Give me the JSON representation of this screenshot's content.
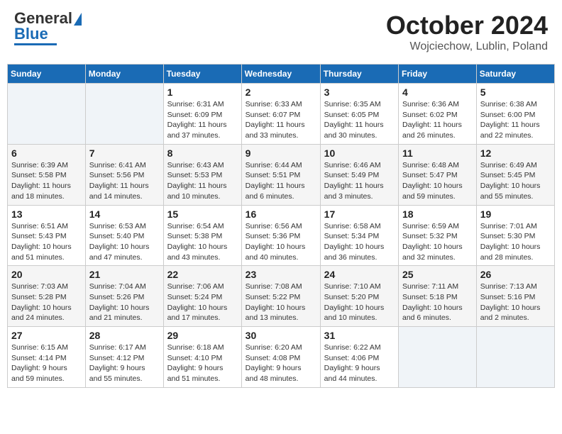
{
  "header": {
    "logo_line1": "General",
    "logo_line2": "Blue",
    "month": "October 2024",
    "location": "Wojciechow, Lublin, Poland"
  },
  "weekdays": [
    "Sunday",
    "Monday",
    "Tuesday",
    "Wednesday",
    "Thursday",
    "Friday",
    "Saturday"
  ],
  "weeks": [
    [
      {
        "day": "",
        "info": ""
      },
      {
        "day": "",
        "info": ""
      },
      {
        "day": "1",
        "info": "Sunrise: 6:31 AM\nSunset: 6:09 PM\nDaylight: 11 hours\nand 37 minutes."
      },
      {
        "day": "2",
        "info": "Sunrise: 6:33 AM\nSunset: 6:07 PM\nDaylight: 11 hours\nand 33 minutes."
      },
      {
        "day": "3",
        "info": "Sunrise: 6:35 AM\nSunset: 6:05 PM\nDaylight: 11 hours\nand 30 minutes."
      },
      {
        "day": "4",
        "info": "Sunrise: 6:36 AM\nSunset: 6:02 PM\nDaylight: 11 hours\nand 26 minutes."
      },
      {
        "day": "5",
        "info": "Sunrise: 6:38 AM\nSunset: 6:00 PM\nDaylight: 11 hours\nand 22 minutes."
      }
    ],
    [
      {
        "day": "6",
        "info": "Sunrise: 6:39 AM\nSunset: 5:58 PM\nDaylight: 11 hours\nand 18 minutes."
      },
      {
        "day": "7",
        "info": "Sunrise: 6:41 AM\nSunset: 5:56 PM\nDaylight: 11 hours\nand 14 minutes."
      },
      {
        "day": "8",
        "info": "Sunrise: 6:43 AM\nSunset: 5:53 PM\nDaylight: 11 hours\nand 10 minutes."
      },
      {
        "day": "9",
        "info": "Sunrise: 6:44 AM\nSunset: 5:51 PM\nDaylight: 11 hours\nand 6 minutes."
      },
      {
        "day": "10",
        "info": "Sunrise: 6:46 AM\nSunset: 5:49 PM\nDaylight: 11 hours\nand 3 minutes."
      },
      {
        "day": "11",
        "info": "Sunrise: 6:48 AM\nSunset: 5:47 PM\nDaylight: 10 hours\nand 59 minutes."
      },
      {
        "day": "12",
        "info": "Sunrise: 6:49 AM\nSunset: 5:45 PM\nDaylight: 10 hours\nand 55 minutes."
      }
    ],
    [
      {
        "day": "13",
        "info": "Sunrise: 6:51 AM\nSunset: 5:43 PM\nDaylight: 10 hours\nand 51 minutes."
      },
      {
        "day": "14",
        "info": "Sunrise: 6:53 AM\nSunset: 5:40 PM\nDaylight: 10 hours\nand 47 minutes."
      },
      {
        "day": "15",
        "info": "Sunrise: 6:54 AM\nSunset: 5:38 PM\nDaylight: 10 hours\nand 43 minutes."
      },
      {
        "day": "16",
        "info": "Sunrise: 6:56 AM\nSunset: 5:36 PM\nDaylight: 10 hours\nand 40 minutes."
      },
      {
        "day": "17",
        "info": "Sunrise: 6:58 AM\nSunset: 5:34 PM\nDaylight: 10 hours\nand 36 minutes."
      },
      {
        "day": "18",
        "info": "Sunrise: 6:59 AM\nSunset: 5:32 PM\nDaylight: 10 hours\nand 32 minutes."
      },
      {
        "day": "19",
        "info": "Sunrise: 7:01 AM\nSunset: 5:30 PM\nDaylight: 10 hours\nand 28 minutes."
      }
    ],
    [
      {
        "day": "20",
        "info": "Sunrise: 7:03 AM\nSunset: 5:28 PM\nDaylight: 10 hours\nand 24 minutes."
      },
      {
        "day": "21",
        "info": "Sunrise: 7:04 AM\nSunset: 5:26 PM\nDaylight: 10 hours\nand 21 minutes."
      },
      {
        "day": "22",
        "info": "Sunrise: 7:06 AM\nSunset: 5:24 PM\nDaylight: 10 hours\nand 17 minutes."
      },
      {
        "day": "23",
        "info": "Sunrise: 7:08 AM\nSunset: 5:22 PM\nDaylight: 10 hours\nand 13 minutes."
      },
      {
        "day": "24",
        "info": "Sunrise: 7:10 AM\nSunset: 5:20 PM\nDaylight: 10 hours\nand 10 minutes."
      },
      {
        "day": "25",
        "info": "Sunrise: 7:11 AM\nSunset: 5:18 PM\nDaylight: 10 hours\nand 6 minutes."
      },
      {
        "day": "26",
        "info": "Sunrise: 7:13 AM\nSunset: 5:16 PM\nDaylight: 10 hours\nand 2 minutes."
      }
    ],
    [
      {
        "day": "27",
        "info": "Sunrise: 6:15 AM\nSunset: 4:14 PM\nDaylight: 9 hours\nand 59 minutes."
      },
      {
        "day": "28",
        "info": "Sunrise: 6:17 AM\nSunset: 4:12 PM\nDaylight: 9 hours\nand 55 minutes."
      },
      {
        "day": "29",
        "info": "Sunrise: 6:18 AM\nSunset: 4:10 PM\nDaylight: 9 hours\nand 51 minutes."
      },
      {
        "day": "30",
        "info": "Sunrise: 6:20 AM\nSunset: 4:08 PM\nDaylight: 9 hours\nand 48 minutes."
      },
      {
        "day": "31",
        "info": "Sunrise: 6:22 AM\nSunset: 4:06 PM\nDaylight: 9 hours\nand 44 minutes."
      },
      {
        "day": "",
        "info": ""
      },
      {
        "day": "",
        "info": ""
      }
    ]
  ]
}
